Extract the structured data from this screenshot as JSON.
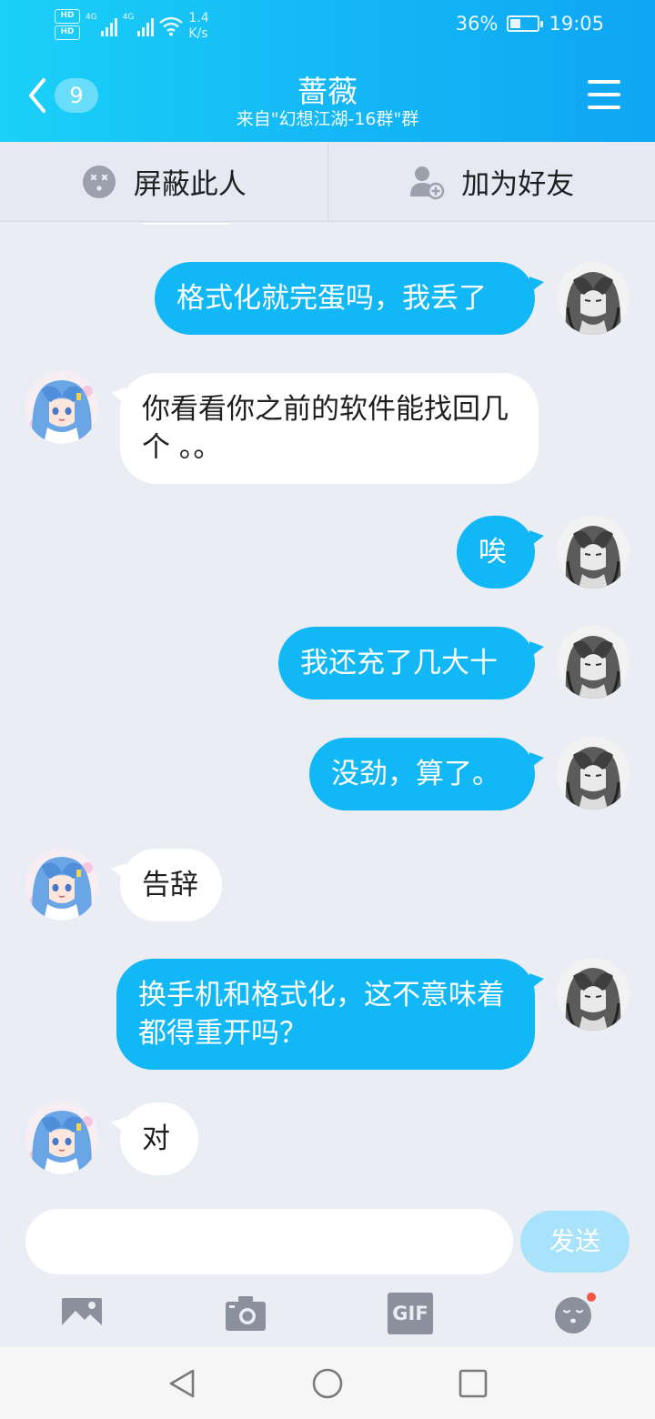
{
  "status_bar": {
    "hd_label_top": "HD",
    "hd_label_bottom": "HD",
    "network_1": "4G",
    "network_2": "4G",
    "speed_value": "1.4",
    "speed_unit": "K/s",
    "battery_percent_text": "36%",
    "battery_level": 0.36,
    "time": "19:05"
  },
  "header": {
    "back_count": "9",
    "title": "蔷薇",
    "subtitle": "来自\"幻想江湖-16群\"群"
  },
  "actions": {
    "block_label": "屏蔽此人",
    "add_friend_label": "加为好友"
  },
  "messages": [
    {
      "side": "out",
      "text": "格式化就完蛋吗，我丢了"
    },
    {
      "side": "in",
      "text": "你看看你之前的软件能找回几个 。。"
    },
    {
      "side": "out",
      "text": "唉"
    },
    {
      "side": "out",
      "text": "我还充了几大十"
    },
    {
      "side": "out",
      "text": "没劲，算了。"
    },
    {
      "side": "in",
      "text": "告辞"
    },
    {
      "side": "out",
      "text": "换手机和格式化，这不意味着都得重开吗？"
    },
    {
      "side": "in",
      "text": "对"
    }
  ],
  "composer": {
    "input_value": "",
    "send_label": "发送"
  },
  "tools": {
    "gif_label": "GIF"
  },
  "colors": {
    "header_start": "#1bd1f7",
    "header_end": "#0fa6f3",
    "bubble_out": "#12b7f5",
    "bubble_in": "#ffffff",
    "send_disabled": "#a8e3fb",
    "chat_bg": "#ebedf5",
    "notify_dot": "#f25643"
  },
  "icons": {
    "back": "chevron-left-icon",
    "menu": "hamburger-menu-icon",
    "block": "block-face-icon",
    "add_friend": "add-user-icon",
    "picture": "picture-icon",
    "camera": "camera-icon",
    "gif": "gif-icon",
    "emoji": "emoji-icon"
  }
}
